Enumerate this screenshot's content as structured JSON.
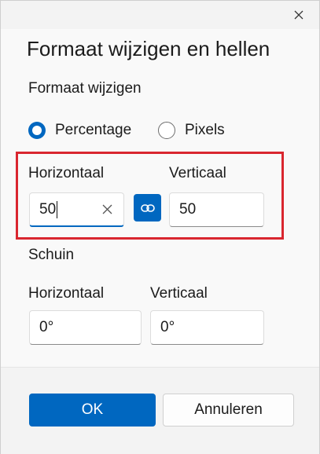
{
  "dialog": {
    "title": "Formaat wijzigen en hellen",
    "close_icon": "close-icon"
  },
  "resize": {
    "section_title": "Formaat wijzigen",
    "options": [
      {
        "label": "Percentage",
        "selected": true
      },
      {
        "label": "Pixels",
        "selected": false
      }
    ],
    "horizontal_label": "Horizontaal",
    "horizontal_value": "50",
    "vertical_label": "Verticaal",
    "vertical_value": "50",
    "link_icon": "link-icon",
    "highlight_color": "#d9262f"
  },
  "skew": {
    "section_title": "Schuin",
    "horizontal_label": "Horizontaal",
    "horizontal_value": "0°",
    "vertical_label": "Verticaal",
    "vertical_value": "0°"
  },
  "footer": {
    "ok_label": "OK",
    "cancel_label": "Annuleren"
  },
  "colors": {
    "accent": "#0067c0"
  }
}
